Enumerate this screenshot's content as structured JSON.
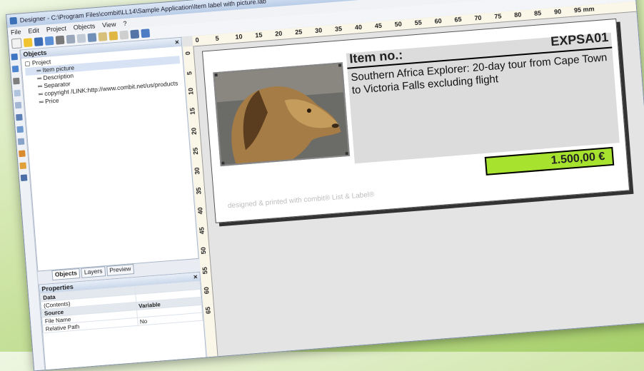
{
  "window": {
    "title": "Designer - C:\\Program Files\\combit\\LL14\\Sample Application\\Item label with picture.lab",
    "menu": [
      "File",
      "Edit",
      "Project",
      "Objects",
      "View",
      "?"
    ]
  },
  "objects_panel": {
    "title": "Objects",
    "root": "Project",
    "items": [
      "Item picture",
      "Description",
      "Separator",
      "copyright /LINK:http://www.combit.net/us/products",
      "Price"
    ]
  },
  "panel_tabs": [
    "Objects",
    "Layers",
    "Preview"
  ],
  "properties_panel": {
    "title": "Properties",
    "rows": [
      {
        "name": "Data",
        "value": ""
      },
      {
        "name": "(Contents)",
        "value": ""
      },
      {
        "name": "Source",
        "value": "Variable"
      },
      {
        "name": "File Name",
        "value": ""
      },
      {
        "name": "Relative Path",
        "value": "No"
      }
    ]
  },
  "ruler": {
    "horizontal": [
      "0",
      "5",
      "10",
      "15",
      "20",
      "25",
      "30",
      "35",
      "40",
      "45",
      "50",
      "55",
      "60",
      "65",
      "70",
      "75",
      "80",
      "85",
      "90",
      "95 mm"
    ],
    "vertical": [
      "0",
      "5",
      "10",
      "15",
      "20",
      "25",
      "30",
      "35",
      "40",
      "45",
      "50",
      "55",
      "60",
      "65"
    ]
  },
  "label": {
    "item_no_label": "Item no.:",
    "item_code": "EXPSA01",
    "description": "Southern Africa Explorer: 20-day tour from Cape Town to Victoria Falls excluding flight",
    "price": "1.500,00 €",
    "credit": "designed & printed with combit® List & Label®"
  }
}
